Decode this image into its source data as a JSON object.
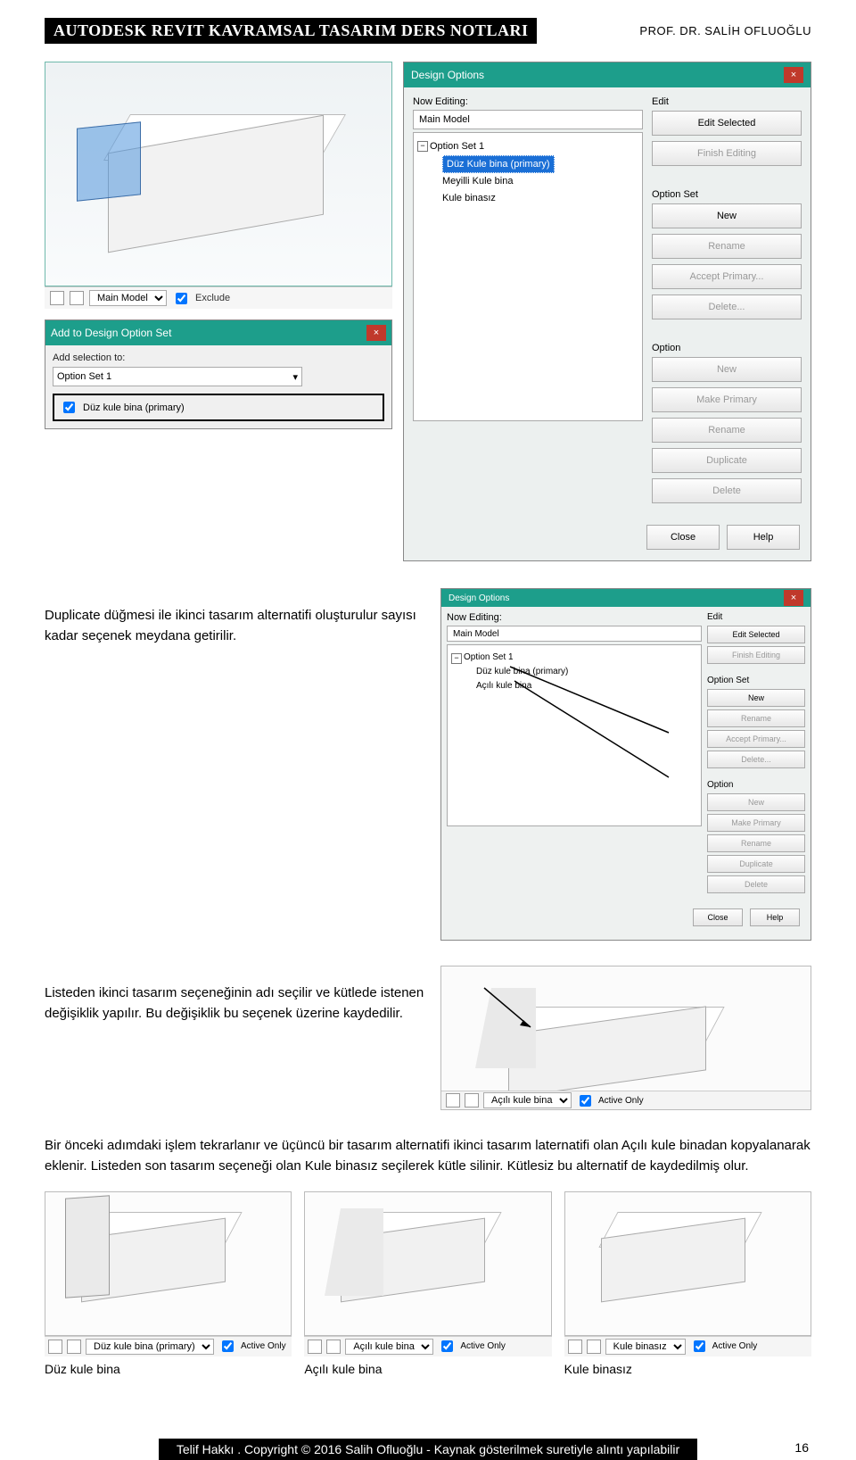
{
  "header": {
    "title": "AUTODESK REVIT KAVRAMSAL TASARIM DERS NOTLARI",
    "author": "PROF. DR. SALİH OFLUOĞLU"
  },
  "statusbar1": {
    "dropdown_value": "Main Model",
    "checkbox_label": "Exclude"
  },
  "addDialog": {
    "title": "Add to Design Option Set",
    "label": "Add selection to:",
    "select_value": "Option Set 1",
    "check_label": "Düz kule bina (primary)"
  },
  "designOptions": {
    "title": "Design Options",
    "now_editing_label": "Now Editing:",
    "now_editing_value": "Main Model",
    "tree_root": "Option Set 1",
    "tree_items": [
      "Düz Kule bina (primary)",
      "Meyilli Kule bina",
      "Kule binasız"
    ],
    "edit_section": "Edit",
    "buttons_edit": [
      "Edit Selected",
      "Finish Editing"
    ],
    "optset_section": "Option Set",
    "buttons_optset": [
      "New",
      "Rename",
      "Accept Primary...",
      "Delete..."
    ],
    "option_section": "Option",
    "buttons_option": [
      "New",
      "Make Primary",
      "Rename",
      "Duplicate",
      "Delete"
    ],
    "close": "Close",
    "help": "Help"
  },
  "para1": "Duplicate düğmesi ile ikinci tasarım alternatifi oluşturulur sayısı kadar seçenek meydana getirilir.",
  "smallDesignOptions": {
    "title": "Design Options",
    "now_editing_label": "Now Editing:",
    "now_editing_value": "Main Model",
    "tree_root": "Option Set 1",
    "tree_items": [
      "Düz kule bina (primary)",
      "Açılı kule bina"
    ],
    "edit_section": "Edit",
    "buttons_edit": [
      "Edit Selected",
      "Finish Editing"
    ],
    "optset_section": "Option Set",
    "buttons_optset": [
      "New",
      "Rename",
      "Accept Primary...",
      "Delete..."
    ],
    "option_section": "Option",
    "buttons_option": [
      "New",
      "Make Primary",
      "Rename",
      "Duplicate",
      "Delete"
    ],
    "close": "Close",
    "help": "Help"
  },
  "para2": "Listeden ikinci tasarım seçeneğinin adı seçilir ve kütlede istenen değişiklik yapılır. Bu değişiklik bu seçenek üzerine kaydedilir.",
  "smallViewStatus": {
    "dropdown": "Açılı kule bina",
    "check": "Active Only"
  },
  "para3": "Bir önceki adımdaki işlem tekrarlanır ve üçüncü bir tasarım alternatifi ikinci tasarım laternatifi olan Açılı kule binadan kopyalanarak eklenir. Listeden son tasarım seçeneği olan Kule binasız seçilerek kütle silinir. Kütlesiz bu alternatif de kaydedilmiş olur.",
  "views": [
    {
      "dropdown": "Düz kule bina (primary)",
      "check": "Active Only",
      "caption": "Düz kule bina"
    },
    {
      "dropdown": "Açılı kule bina",
      "check": "Active Only",
      "caption": "Açılı kule bina"
    },
    {
      "dropdown": "Kule binasız",
      "check": "Active Only",
      "caption": "Kule binasız"
    }
  ],
  "footer": {
    "text": "Telif Hakkı . Copyright © 2016 Salih Ofluoğlu - Kaynak gösterilmek suretiyle alıntı yapılabilir",
    "page": "16"
  }
}
